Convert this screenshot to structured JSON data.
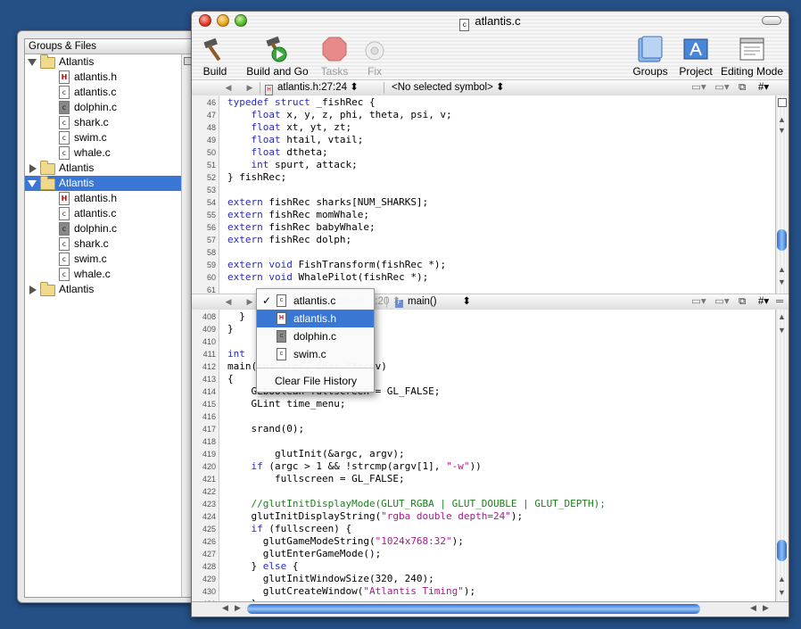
{
  "drawer": {
    "header": "Groups & Files",
    "items": [
      {
        "label": "Atlantis",
        "kind": "folder",
        "expanded": true,
        "level": 0
      },
      {
        "label": "atlantis.h",
        "kind": "h",
        "level": 1
      },
      {
        "label": "atlantis.c",
        "kind": "c",
        "level": 1
      },
      {
        "label": "dolphin.c",
        "kind": "o",
        "level": 1
      },
      {
        "label": "shark.c",
        "kind": "c",
        "level": 1
      },
      {
        "label": "swim.c",
        "kind": "c",
        "level": 1
      },
      {
        "label": "whale.c",
        "kind": "c",
        "level": 1
      },
      {
        "label": "Atlantis",
        "kind": "folder",
        "expanded": false,
        "level": 0
      },
      {
        "label": "Atlantis",
        "kind": "folder",
        "expanded": true,
        "level": 0,
        "selected": true
      },
      {
        "label": "atlantis.h",
        "kind": "h",
        "level": 1
      },
      {
        "label": "atlantis.c",
        "kind": "c",
        "level": 1
      },
      {
        "label": "dolphin.c",
        "kind": "o",
        "level": 1
      },
      {
        "label": "shark.c",
        "kind": "c",
        "level": 1
      },
      {
        "label": "swim.c",
        "kind": "c",
        "level": 1
      },
      {
        "label": "whale.c",
        "kind": "c",
        "level": 1
      },
      {
        "label": "Atlantis",
        "kind": "folder",
        "expanded": false,
        "level": 0
      }
    ]
  },
  "window": {
    "title": "atlantis.c",
    "title_icon": "c",
    "toolbar": {
      "build": "Build",
      "build_and_go": "Build and Go",
      "tasks": "Tasks",
      "fix": "Fix",
      "groups": "Groups",
      "project": "Project",
      "editing_mode": "Editing Mode"
    }
  },
  "top_pane": {
    "file_popup": "atlantis.h:27:24",
    "symbol_popup": "<No selected symbol>",
    "hash": "#",
    "lines": [
      {
        "n": "46",
        "t": "typedef struct _fishRec {"
      },
      {
        "n": "47",
        "t": "    float x, y, z, phi, theta, psi, v;"
      },
      {
        "n": "48",
        "t": "    float xt, yt, zt;"
      },
      {
        "n": "49",
        "t": "    float htail, vtail;"
      },
      {
        "n": "50",
        "t": "    float dtheta;"
      },
      {
        "n": "51",
        "t": "    int spurt, attack;"
      },
      {
        "n": "52",
        "t": "} fishRec;"
      },
      {
        "n": "53",
        "t": ""
      },
      {
        "n": "54",
        "t": "extern fishRec sharks[NUM_SHARKS];"
      },
      {
        "n": "55",
        "t": "extern fishRec momWhale;"
      },
      {
        "n": "56",
        "t": "extern fishRec babyWhale;"
      },
      {
        "n": "57",
        "t": "extern fishRec dolph;"
      },
      {
        "n": "58",
        "t": ""
      },
      {
        "n": "59",
        "t": "extern void FishTransform(fishRec *);"
      },
      {
        "n": "60",
        "t": "extern void WhalePilot(fishRec *);"
      },
      {
        "n": "61",
        "t": ""
      }
    ]
  },
  "bottom_pane": {
    "file_popup": "atlantis.c:20",
    "symbol_popup": "main()",
    "hash": "#",
    "lines": [
      {
        "n": "408",
        "t": "  }"
      },
      {
        "n": "409",
        "t": "}"
      },
      {
        "n": "410",
        "t": ""
      },
      {
        "n": "411",
        "t": "int"
      },
      {
        "n": "412",
        "t": "main(int argc, char **argv)"
      },
      {
        "n": "413",
        "t": "{"
      },
      {
        "n": "414",
        "t": "    GLboolean fullscreen = GL_FALSE;"
      },
      {
        "n": "415",
        "t": "    GLint time_menu;"
      },
      {
        "n": "416",
        "t": ""
      },
      {
        "n": "417",
        "t": "    srand(0);"
      },
      {
        "n": "418",
        "t": ""
      },
      {
        "n": "419",
        "t": "        glutInit(&argc, argv);"
      },
      {
        "n": "420",
        "t": "    if (argc > 1 && !strcmp(argv[1], \"-w\"))"
      },
      {
        "n": "421",
        "t": "        fullscreen = GL_FALSE;"
      },
      {
        "n": "422",
        "t": ""
      },
      {
        "n": "423",
        "t": "    //glutInitDisplayMode(GLUT_RGBA | GLUT_DOUBLE | GLUT_DEPTH);"
      },
      {
        "n": "424",
        "t": "    glutInitDisplayString(\"rgba double depth=24\");"
      },
      {
        "n": "425",
        "t": "    if (fullscreen) {"
      },
      {
        "n": "426",
        "t": "      glutGameModeString(\"1024x768:32\");"
      },
      {
        "n": "427",
        "t": "      glutEnterGameMode();"
      },
      {
        "n": "428",
        "t": "    } else {"
      },
      {
        "n": "429",
        "t": "      glutInitWindowSize(320, 240);"
      },
      {
        "n": "430",
        "t": "      glutCreateWindow(\"Atlantis Timing\");"
      },
      {
        "n": "431",
        "t": "    }"
      },
      {
        "n": "432",
        "t": ""
      }
    ]
  },
  "popup_menu": {
    "items": [
      {
        "label": "atlantis.c",
        "icon": "c",
        "checked": true,
        "highlighted": false
      },
      {
        "label": "atlantis.h",
        "icon": "h",
        "checked": false,
        "highlighted": true
      },
      {
        "label": "dolphin.c",
        "icon": "o",
        "checked": false,
        "highlighted": false
      },
      {
        "label": "swim.c",
        "icon": "c",
        "checked": false,
        "highlighted": false
      }
    ],
    "check_mark": "✓",
    "clear": "Clear File History"
  },
  "colors": {
    "desktop": "#245086",
    "selection": "#3a77d4",
    "keyword": "#2a2ac0",
    "comment": "#1b7f1b",
    "string": "#a01c8c"
  }
}
